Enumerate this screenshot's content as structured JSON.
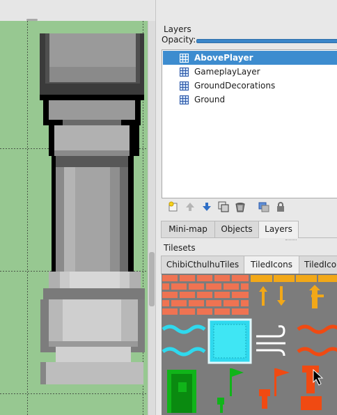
{
  "layers_panel": {
    "title": "Layers",
    "opacity_label": "Opacity:",
    "layers": [
      {
        "name": "AbovePlayer",
        "selected": true
      },
      {
        "name": "GameplayLayer",
        "selected": false
      },
      {
        "name": "GroundDecorations",
        "selected": false
      },
      {
        "name": "Ground",
        "selected": false
      }
    ],
    "toolbar_icons": [
      "new-layer-icon",
      "raise-layer-icon",
      "lower-layer-icon",
      "duplicate-layer-icon",
      "delete-layer-icon",
      "layer-group-icon",
      "lock-icon"
    ]
  },
  "bottom_tabs": [
    {
      "label": "Mini-map",
      "active": false
    },
    {
      "label": "Objects",
      "active": false
    },
    {
      "label": "Layers",
      "active": true
    }
  ],
  "tilesets_panel": {
    "title": "Tilesets",
    "tabs": [
      {
        "label": "ChibiCthulhuTiles",
        "active": false
      },
      {
        "label": "TiledIcons",
        "active": true
      },
      {
        "label": "TiledIcons",
        "active": false
      }
    ]
  },
  "colors": {
    "map_background": "#97c891",
    "selection": "#3d8ccf",
    "tileset_background": "#7c7c7c"
  }
}
